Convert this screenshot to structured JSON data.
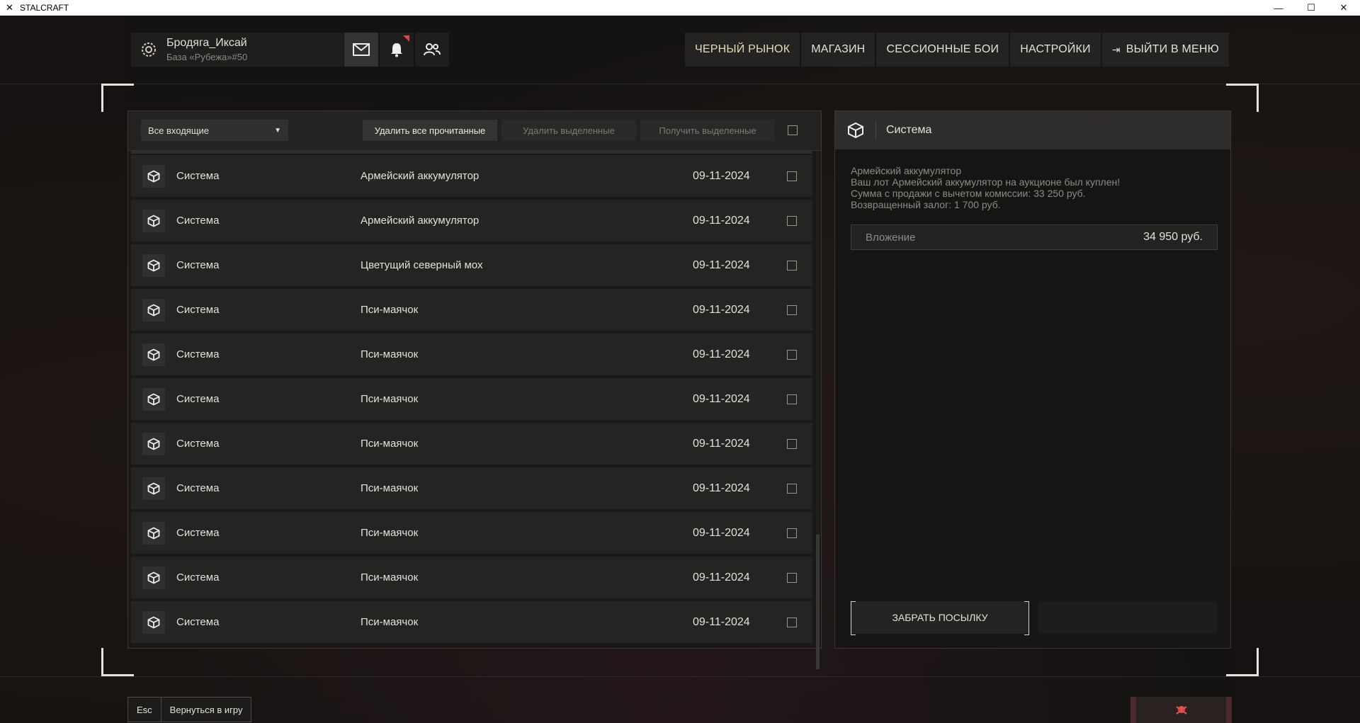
{
  "window": {
    "title": "STALCRAFT",
    "minimize": "—",
    "maximize": "☐",
    "close": "✕"
  },
  "profile": {
    "name": "Бродяга_Иксай",
    "base": "База «Рубежа»#50"
  },
  "top_icons": {
    "mail": "✉",
    "bell": "🔔",
    "friends": "👥"
  },
  "nav": {
    "black_market": "ЧЕРНЫЙ РЫНОК",
    "shop": "МАГАЗИН",
    "session_battles": "СЕССИОННЫЕ БОИ",
    "settings": "НАСТРОЙКИ",
    "exit_menu": "ВЫЙТИ В МЕНЮ"
  },
  "toolbar": {
    "filter_value": "Все входящие",
    "delete_read": "Удалить все прочитанные",
    "delete_selected": "Удалить выделенные",
    "get_selected": "Получить выделенные"
  },
  "messages": [
    {
      "sender": "Система",
      "subject": "Армейский аккумулятор",
      "date": "09-11-2024"
    },
    {
      "sender": "Система",
      "subject": "Армейский аккумулятор",
      "date": "09-11-2024"
    },
    {
      "sender": "Система",
      "subject": "Цветущий северный мох",
      "date": "09-11-2024"
    },
    {
      "sender": "Система",
      "subject": "Пси-маячок",
      "date": "09-11-2024"
    },
    {
      "sender": "Система",
      "subject": "Пси-маячок",
      "date": "09-11-2024"
    },
    {
      "sender": "Система",
      "subject": "Пси-маячок",
      "date": "09-11-2024"
    },
    {
      "sender": "Система",
      "subject": "Пси-маячок",
      "date": "09-11-2024"
    },
    {
      "sender": "Система",
      "subject": "Пси-маячок",
      "date": "09-11-2024"
    },
    {
      "sender": "Система",
      "subject": "Пси-маячок",
      "date": "09-11-2024"
    },
    {
      "sender": "Система",
      "subject": "Пси-маячок",
      "date": "09-11-2024"
    },
    {
      "sender": "Система",
      "subject": "Пси-маячок",
      "date": "09-11-2024"
    }
  ],
  "detail": {
    "sender": "Система",
    "body_lines": [
      "Армейский аккумулятор",
      "Ваш лот Армейский аккумулятор на аукционе был куплен!",
      "Сумма с продажи с вычетом комиссии: 33 250 руб.",
      "Возвращенный залог: 1 700 руб."
    ],
    "attachment_label": "Вложение",
    "attachment_value": "34 950 руб.",
    "claim_button": "ЗАБРАТЬ ПОСЫЛКУ"
  },
  "bottom": {
    "esc_key": "Esc",
    "return_label": "Вернуться в игру"
  }
}
